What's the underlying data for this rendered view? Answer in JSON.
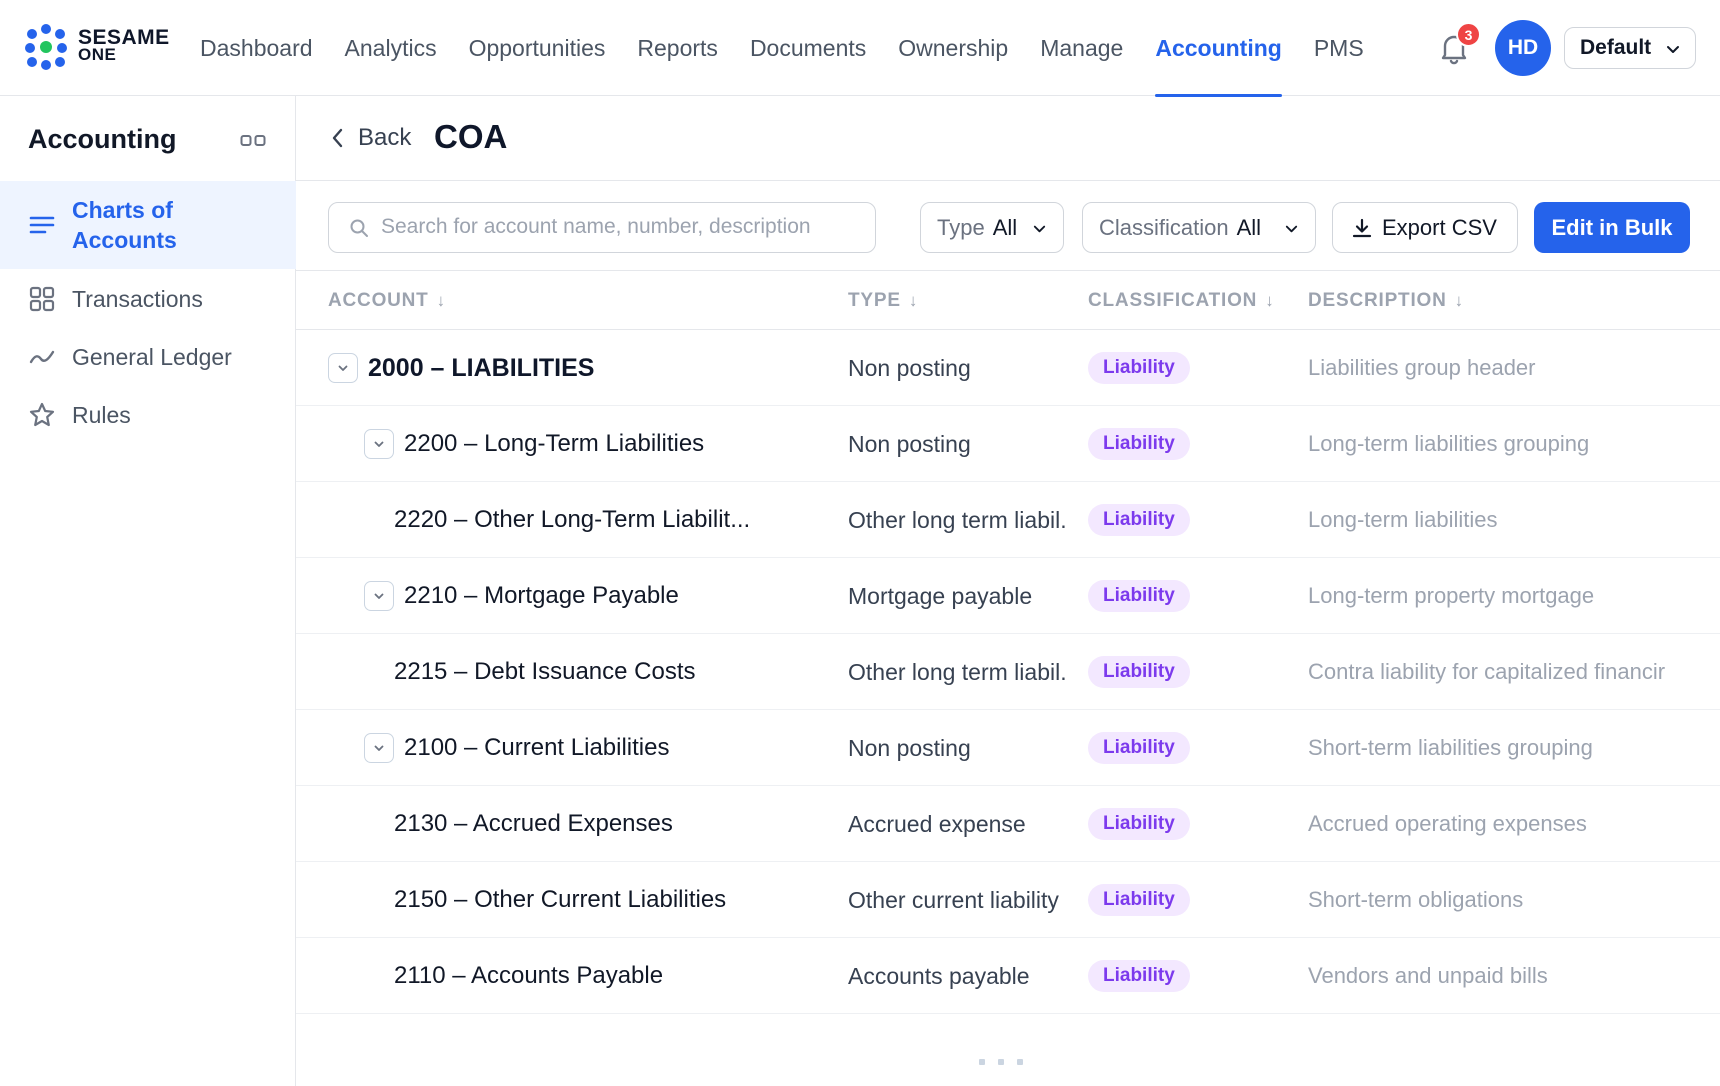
{
  "brand": {
    "line1": "SESAME",
    "line2": "ONE"
  },
  "nav": {
    "items": [
      {
        "label": "Dashboard"
      },
      {
        "label": "Analytics"
      },
      {
        "label": "Opportunities"
      },
      {
        "label": "Reports"
      },
      {
        "label": "Documents"
      },
      {
        "label": "Ownership"
      },
      {
        "label": "Manage"
      },
      {
        "label": "Accounting",
        "active": true
      },
      {
        "label": "PMS"
      }
    ],
    "notification_count": "3",
    "avatar_initials": "HD",
    "profile_selector": "Default"
  },
  "sidebar": {
    "title": "Accounting",
    "items": [
      {
        "label": "Charts of Accounts",
        "icon": "list-icon",
        "active": true
      },
      {
        "label": "Transactions",
        "icon": "grid-icon"
      },
      {
        "label": "General Ledger",
        "icon": "trend-icon"
      },
      {
        "label": "Rules",
        "icon": "star-icon"
      }
    ]
  },
  "page": {
    "back_label": "Back",
    "title": "COA"
  },
  "toolbar": {
    "search_placeholder": "Search for account name, number, description",
    "type_filter": {
      "label": "Type",
      "value": "All"
    },
    "classification_filter": {
      "label": "Classification",
      "value": "All"
    },
    "export_label": "Export CSV",
    "bulk_label": "Edit in Bulk"
  },
  "table": {
    "columns": [
      "ACCOUNT",
      "TYPE",
      "CLASSIFICATION",
      "DESCRIPTION"
    ],
    "rows": [
      {
        "account": "2000 – LIABILITIES",
        "level": 0,
        "expandable": true,
        "type": "Non posting",
        "classification": "Liability",
        "description": "Liabilities group header"
      },
      {
        "account": "2200 – Long-Term Liabilities",
        "level": 1,
        "expandable": true,
        "type": "Non posting",
        "classification": "Liability",
        "description": "Long-term liabilities grouping"
      },
      {
        "account": "2220 – Other Long-Term Liabilit...",
        "level": 2,
        "expandable": false,
        "type": "Other long term liabil.",
        "classification": "Liability",
        "description": "Long-term liabilities"
      },
      {
        "account": "2210 – Mortgage Payable",
        "level": 1,
        "expandable": true,
        "type": "Mortgage payable",
        "classification": "Liability",
        "description": "Long-term property mortgage"
      },
      {
        "account": "2215 – Debt Issuance Costs",
        "level": 2,
        "expandable": false,
        "type": "Other long term liabil.",
        "classification": "Liability",
        "description": "Contra liability for capitalized financir"
      },
      {
        "account": "2100 – Current Liabilities",
        "level": 1,
        "expandable": true,
        "type": "Non posting",
        "classification": "Liability",
        "description": "Short-term liabilities grouping"
      },
      {
        "account": "2130 – Accrued Expenses",
        "level": 2,
        "expandable": false,
        "type": "Accrued expense",
        "classification": "Liability",
        "description": "Accrued operating expenses"
      },
      {
        "account": "2150 – Other Current Liabilities",
        "level": 2,
        "expandable": false,
        "type": "Other current liability",
        "classification": "Liability",
        "description": "Short-term obligations"
      },
      {
        "account": "2110 – Accounts Payable",
        "level": 2,
        "expandable": false,
        "type": "Accounts payable",
        "classification": "Liability",
        "description": "Vendors and unpaid bills"
      }
    ]
  },
  "colors": {
    "accent": "#2563eb",
    "badge_bg": "#f3e8ff",
    "badge_text": "#7c3aed",
    "alert": "#ef4444"
  }
}
